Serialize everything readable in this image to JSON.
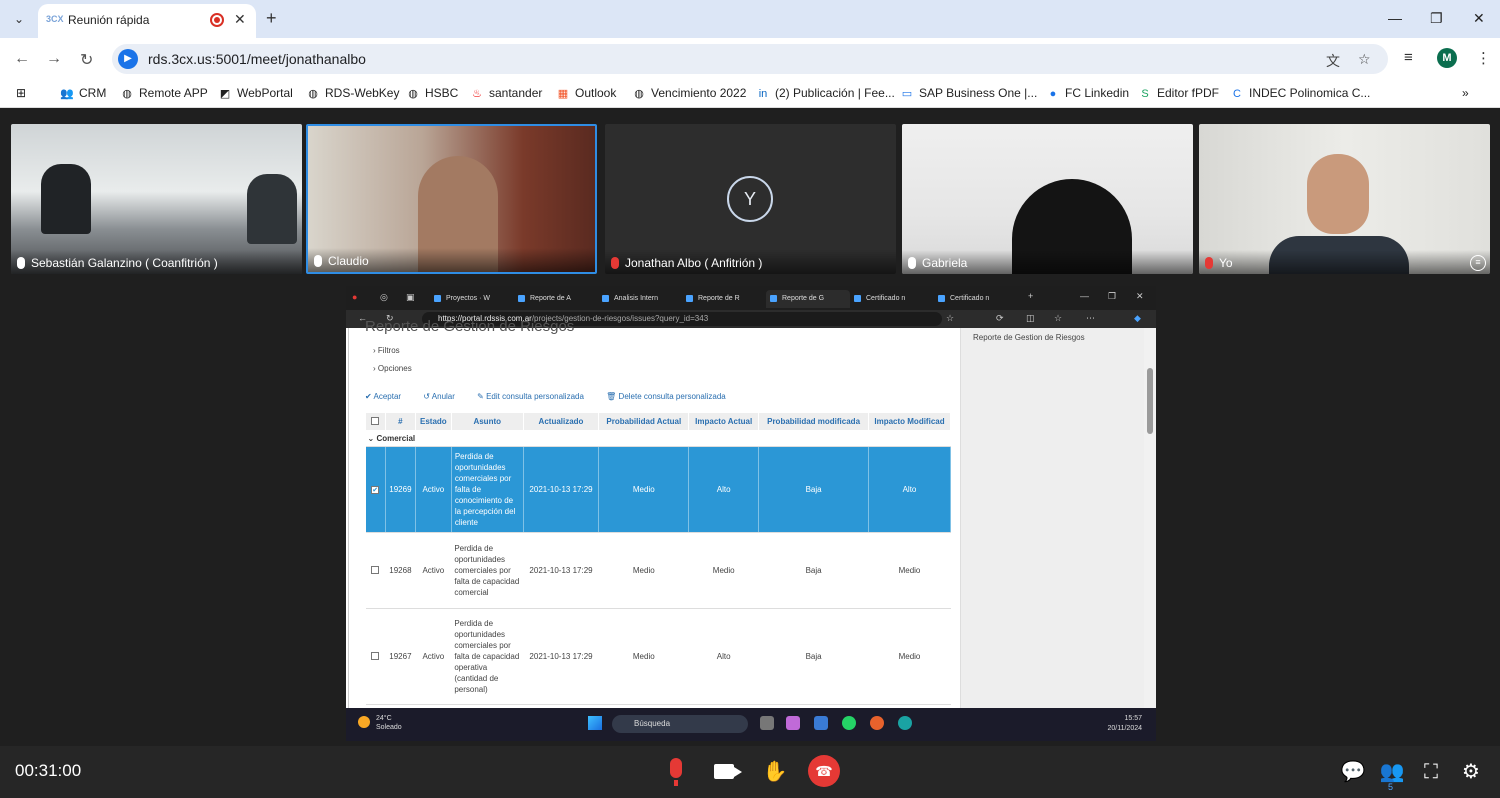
{
  "browser": {
    "tab_title": "Reunión rápida",
    "tab_favicon": "3CX",
    "url": "rds.3cx.us:5001/meet/jonathanalbo",
    "profile_initial": "M"
  },
  "bookmarks": [
    {
      "label": "CRM",
      "icon": "people-icon"
    },
    {
      "label": "Remote APP",
      "icon": "globe-icon"
    },
    {
      "label": "WebPortal",
      "icon": "webportal-icon"
    },
    {
      "label": "RDS-WebKey",
      "icon": "globe-icon"
    },
    {
      "label": "HSBC",
      "icon": "globe-icon"
    },
    {
      "label": "santander",
      "icon": "santander-icon"
    },
    {
      "label": "Outlook",
      "icon": "windows-icon"
    },
    {
      "label": "Vencimiento 2022",
      "icon": "globe-icon"
    },
    {
      "label": "(2) Publicación | Fee...",
      "icon": "linkedin-icon"
    },
    {
      "label": "SAP Business One |...",
      "icon": "sap-icon"
    },
    {
      "label": "FC Linkedin",
      "icon": "linkedin-icon"
    },
    {
      "label": "Editor fPDF",
      "icon": "editor-icon"
    },
    {
      "label": "INDEC Polinomica C...",
      "icon": "indec-icon"
    }
  ],
  "participants": [
    {
      "name": "Sebastián Galanzino ( Coanfitrión )",
      "muted": false
    },
    {
      "name": "Claudio",
      "muted": false,
      "speaking": true
    },
    {
      "name": "Jonathan Albo ( Anfitrión )",
      "muted": true,
      "initial": "Y"
    },
    {
      "name": "Gabriela",
      "muted": false
    },
    {
      "name": "Yo",
      "muted": true
    }
  ],
  "shared_screen": {
    "tabs": [
      "Proyectos · W",
      "Reporte de A",
      "Analisis Intern",
      "Reporte de R",
      "Reporte de G",
      "Certificado n",
      "Certificado n"
    ],
    "url_domain": "https://portal.rdssis.com.ar",
    "url_path": "/projects/gestion-de-riesgos/issues?query_id=343",
    "heading": "Reporte de Gestion de Riesgos",
    "filters_label": "Filtros",
    "options_label": "Opciones",
    "actions": {
      "apply": "Aceptar",
      "cancel": "Anular",
      "edit": "Edit consulta personalizada",
      "delete": "Delete consulta personalizada"
    },
    "side_link": "Reporte de Gestion de Riesgos",
    "columns": [
      "#",
      "Estado",
      "Asunto",
      "Actualizado",
      "Probabilidad Actual",
      "Impacto Actual",
      "Probabilidad modificada",
      "Impacto Modificad"
    ],
    "group": "Comercial",
    "rows": [
      {
        "id": "19269",
        "estado": "Activo",
        "asunto": "Perdida de oportunidades comerciales por falta de conocimiento de la percepción del cliente",
        "actualizado": "2021-10-13 17:29",
        "prob_actual": "Medio",
        "impacto_actual": "Alto",
        "prob_mod": "Baja",
        "impacto_mod": "Alto",
        "selected": true
      },
      {
        "id": "19268",
        "estado": "Activo",
        "asunto": "Perdida de oportunidades comerciales por falta de capacidad comercial",
        "actualizado": "2021-10-13 17:29",
        "prob_actual": "Medio",
        "impacto_actual": "Medio",
        "prob_mod": "Baja",
        "impacto_mod": "Medio",
        "selected": false
      },
      {
        "id": "19267",
        "estado": "Activo",
        "asunto": "Perdida de oportunidades comerciales por falta de capacidad operativa (cantidad de personal)",
        "actualizado": "2021-10-13 17:29",
        "prob_actual": "Medio",
        "impacto_actual": "Alto",
        "prob_mod": "Baja",
        "impacto_mod": "Medio",
        "selected": false
      }
    ],
    "taskbar": {
      "temp": "24°C",
      "weather": "Soleado",
      "search": "Búsqueda",
      "time": "15:57",
      "date": "20/11/2024"
    }
  },
  "meeting_bar": {
    "timer": "00:31:00",
    "participants_count": "5"
  }
}
